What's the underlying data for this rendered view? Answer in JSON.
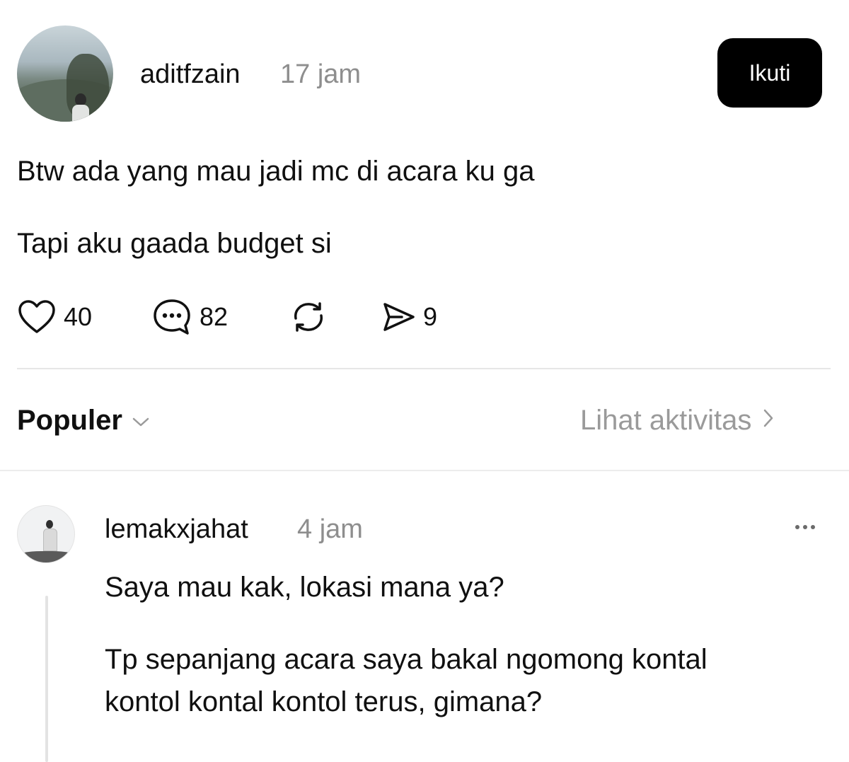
{
  "post": {
    "author": "aditfzain",
    "time": "17 jam",
    "follow_label": "Ikuti",
    "lines": [
      "Btw ada yang mau jadi mc di acara ku ga",
      "Tapi aku gaada budget si"
    ],
    "actions": {
      "likes": "40",
      "comments": "82",
      "shares": "9"
    }
  },
  "replies_header": {
    "sort_label": "Populer",
    "activity_label": "Lihat aktivitas"
  },
  "reply": {
    "author": "lemakxjahat",
    "time": "4 jam",
    "lines": [
      "Saya mau kak, lokasi mana ya?",
      "Tp sepanjang acara saya bakal ngomong kontal",
      "kontol kontal kontol terus, gimana?"
    ]
  },
  "icons": {
    "like": "heart-icon",
    "comment": "comment-bubble-icon",
    "repost": "repost-icon",
    "share": "send-icon",
    "sort": "chevron-down-icon",
    "activity": "chevron-right-icon",
    "more": "more-icon"
  },
  "colors": {
    "text": "#101010",
    "muted": "#8e8e8e",
    "button_bg": "#000000",
    "button_text": "#ffffff",
    "divider": "#e6e6e6"
  }
}
